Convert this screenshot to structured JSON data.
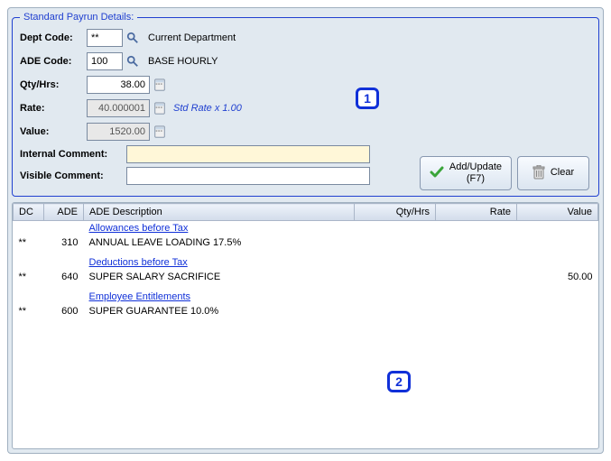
{
  "legend": "Standard Payrun Details:",
  "labels": {
    "dept": "Dept Code:",
    "ade": "ADE Code:",
    "qty": "Qty/Hrs:",
    "rate": "Rate:",
    "value": "Value:",
    "internal": "Internal Comment:",
    "visible": "Visible Comment:"
  },
  "fields": {
    "dept_code": "**",
    "dept_desc": "Current Department",
    "ade_code": "100",
    "ade_desc": "BASE HOURLY",
    "qty": "38.00",
    "rate": "40.000001",
    "std_rate_note": "Std Rate x 1.00",
    "value": "1520.00",
    "internal_comment": "",
    "visible_comment": ""
  },
  "buttons": {
    "add_update": "Add/Update\n(F7)",
    "clear": "Clear"
  },
  "callouts": {
    "one": "1",
    "two": "2"
  },
  "grid": {
    "headers": {
      "dc": "DC",
      "ade": "ADE",
      "desc": "ADE Description",
      "qty": "Qty/Hrs",
      "rate": "Rate",
      "value": "Value"
    },
    "sections": [
      {
        "title": "Allowances before Tax",
        "rows": [
          {
            "dc": "**",
            "ade": "310",
            "desc": "ANNUAL LEAVE LOADING 17.5%",
            "qty": "",
            "rate": "",
            "value": ""
          }
        ]
      },
      {
        "title": "Deductions before Tax",
        "rows": [
          {
            "dc": "**",
            "ade": "640",
            "desc": "SUPER SALARY SACRIFICE",
            "qty": "",
            "rate": "",
            "value": "50.00"
          }
        ]
      },
      {
        "title": "Employee Entitlements",
        "rows": [
          {
            "dc": "**",
            "ade": "600",
            "desc": "SUPER GUARANTEE 10.0%",
            "qty": "",
            "rate": "",
            "value": ""
          }
        ]
      }
    ]
  }
}
